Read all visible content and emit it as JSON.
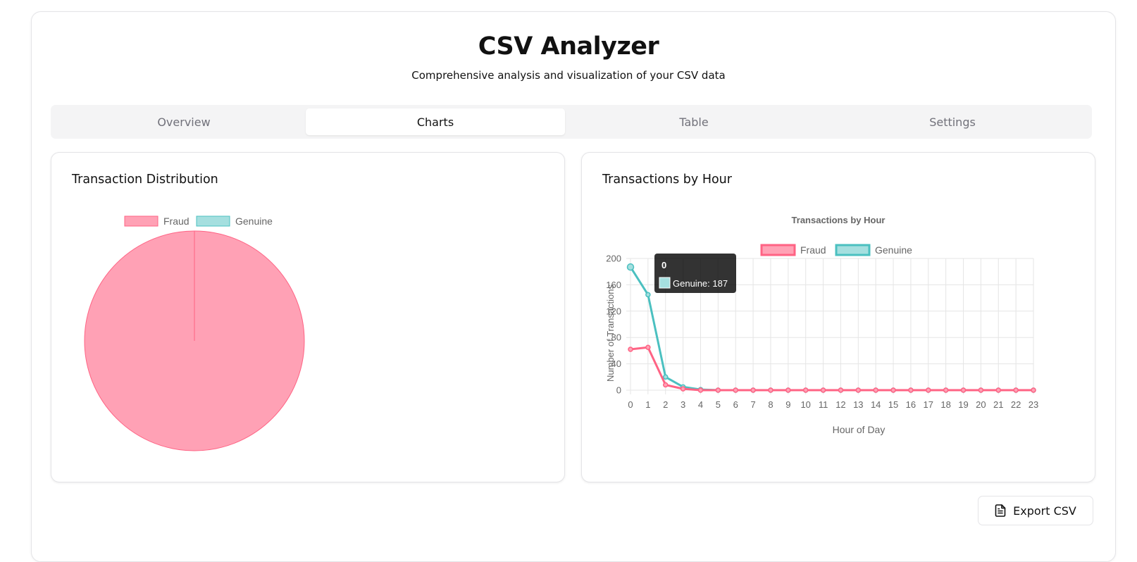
{
  "app": {
    "title": "CSV Analyzer",
    "subtitle": "Comprehensive analysis and visualization of your CSV data"
  },
  "tabs": [
    {
      "label": "Overview",
      "active": false
    },
    {
      "label": "Charts",
      "active": true
    },
    {
      "label": "Table",
      "active": false
    },
    {
      "label": "Settings",
      "active": false
    }
  ],
  "panels": {
    "distribution": {
      "title": "Transaction Distribution"
    },
    "hourly": {
      "title": "Transactions by Hour"
    }
  },
  "export": {
    "label": "Export CSV",
    "icon": "file-text-icon"
  },
  "colors": {
    "fraud": "#ff6384",
    "fraud_fill": "#ffa1b5",
    "genuine": "#4bc0c0",
    "genuine_fill": "#a5dfdf"
  },
  "chart_data": [
    {
      "type": "pie",
      "title": "",
      "categories": [
        "Fraud",
        "Genuine"
      ],
      "values": [
        1,
        0
      ],
      "legend": "top"
    },
    {
      "type": "line",
      "title": "Transactions by Hour",
      "xlabel": "Hour of Day",
      "ylabel": "Number of Transactions",
      "x": [
        0,
        1,
        2,
        3,
        4,
        5,
        6,
        7,
        8,
        9,
        10,
        11,
        12,
        13,
        14,
        15,
        16,
        17,
        18,
        19,
        20,
        21,
        22,
        23
      ],
      "ylim": [
        0,
        200
      ],
      "yticks": [
        0,
        40,
        80,
        120,
        160,
        200
      ],
      "grid": true,
      "legend": "top",
      "series": [
        {
          "name": "Fraud",
          "values": [
            62,
            65,
            8,
            2,
            0,
            0,
            0,
            0,
            0,
            0,
            0,
            0,
            0,
            0,
            0,
            0,
            0,
            0,
            0,
            0,
            0,
            0,
            0,
            0
          ]
        },
        {
          "name": "Genuine",
          "values": [
            187,
            145,
            20,
            5,
            1,
            0,
            0,
            0,
            0,
            0,
            0,
            0,
            0,
            0,
            0,
            0,
            0,
            0,
            0,
            0,
            0,
            0,
            0,
            0
          ]
        }
      ],
      "tooltip": {
        "title": "0",
        "label": "Genuine: 187",
        "series_index": 1,
        "point_index": 0
      }
    }
  ]
}
